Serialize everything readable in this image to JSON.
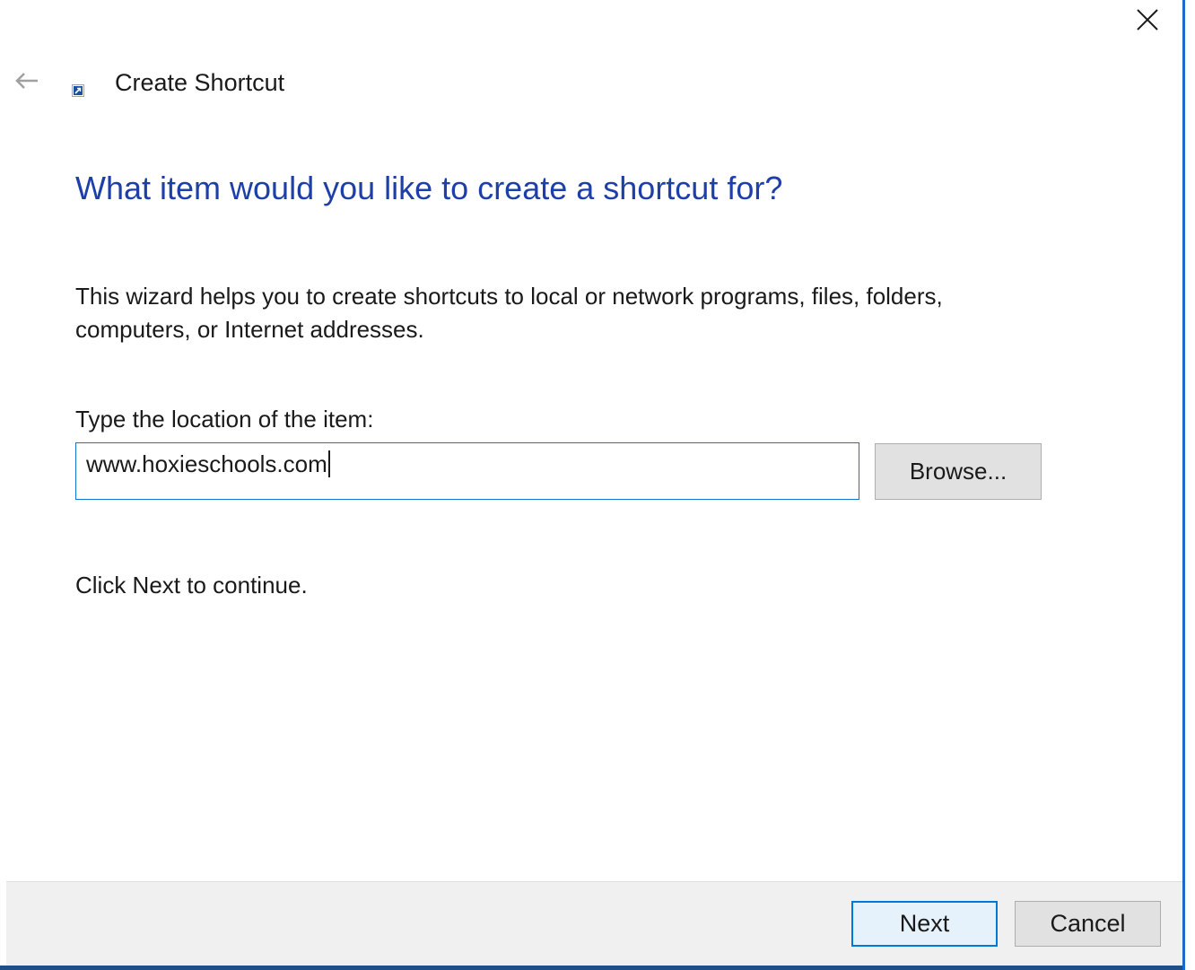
{
  "window": {
    "title": "Create Shortcut",
    "close_icon": "close-icon",
    "back_icon": "back-arrow-icon",
    "title_icon": "shortcut-icon"
  },
  "main": {
    "heading": "What item would you like to create a shortcut for?",
    "description": "This wizard helps you to create shortcuts to local or network programs, files, folders, computers, or Internet addresses.",
    "location_label": "Type the location of the item:",
    "location_value": "www.hoxieschools.com",
    "browse_label": "Browse...",
    "continue_text": "Click Next to continue."
  },
  "footer": {
    "next_label": "Next",
    "cancel_label": "Cancel"
  },
  "colors": {
    "heading": "#1e3fa8",
    "accent": "#0078d7",
    "footer_bg": "#f0f0f0"
  }
}
